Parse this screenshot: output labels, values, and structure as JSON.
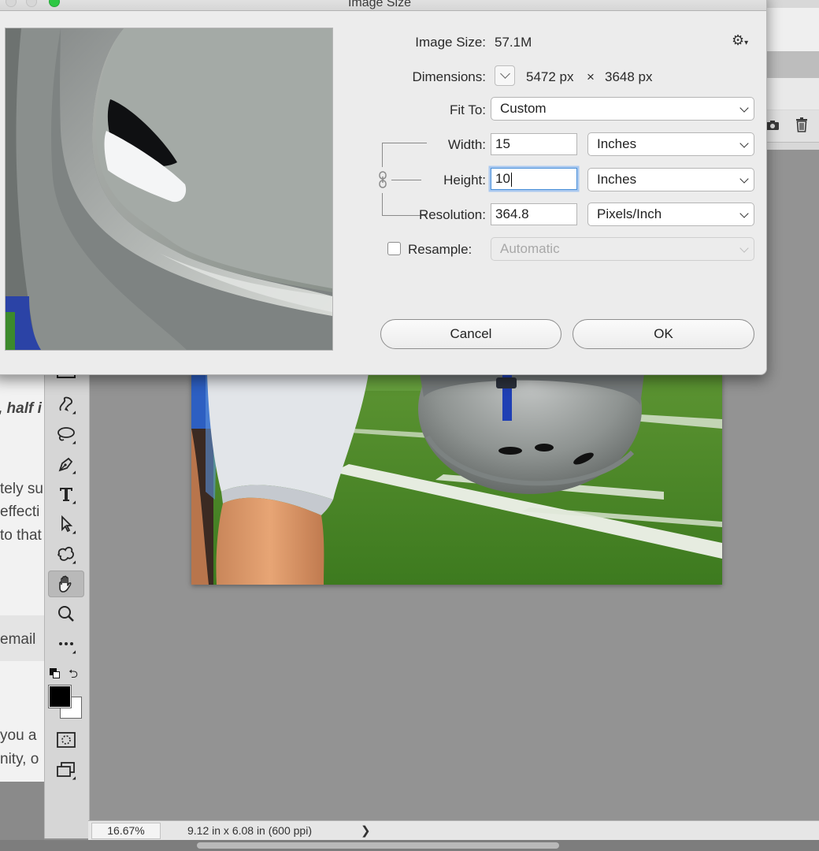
{
  "dialog": {
    "title": "Image Size",
    "image_size_label": "Image Size:",
    "image_size_value": "57.1M",
    "dimensions_label": "Dimensions:",
    "dimensions_width": "5472 px",
    "dimensions_sep": "×",
    "dimensions_height": "3648 px",
    "fit_to_label": "Fit To:",
    "fit_to_value": "Custom",
    "width_label": "Width:",
    "width_value": "15",
    "width_unit": "Inches",
    "height_label": "Height:",
    "height_value": "10",
    "height_unit": "Inches",
    "resolution_label": "Resolution:",
    "resolution_value": "364.8",
    "resolution_unit": "Pixels/Inch",
    "resample_label": "Resample:",
    "resample_value": "Automatic",
    "resample_checked": false,
    "cancel_label": "Cancel",
    "ok_label": "OK"
  },
  "left_page_snippets": [
    ", half i",
    "tely su",
    "effecti",
    "to that",
    "email",
    " you a",
    "nity, o"
  ],
  "statusbar": {
    "zoom": "16.67%",
    "doc_info": "9.12 in x 6.08 in (600 ppi)",
    "arrow": "❯"
  },
  "colors": {
    "dialog_bg": "#ececec",
    "workspace_bg": "#939393",
    "focus_ring": "#4a90d9",
    "traffic_green": "#2ec844"
  },
  "tools": [
    "freeform-pen-icon",
    "lasso-icon",
    "pen-icon",
    "type-icon",
    "path-selection-icon",
    "custom-shape-icon",
    "hand-icon",
    "zoom-icon",
    "more-tools-icon"
  ]
}
